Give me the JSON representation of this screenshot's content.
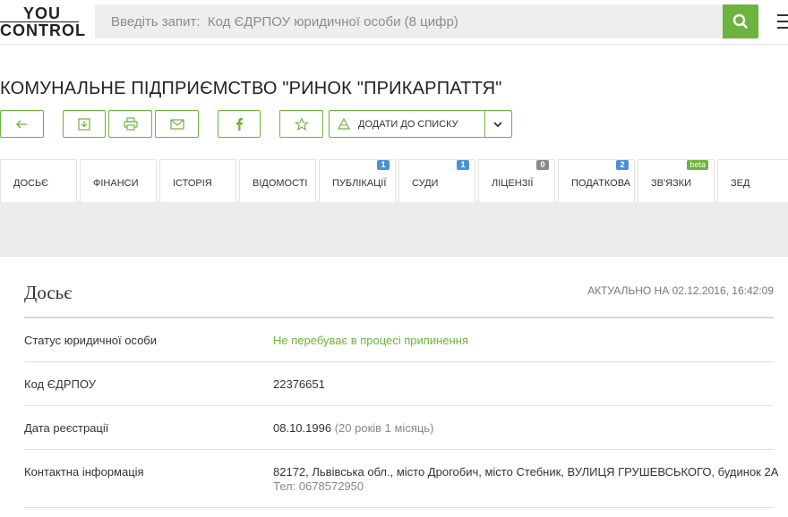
{
  "header": {
    "logo_top": "YOU",
    "logo_bottom": "CONTROL",
    "search_placeholder": "Введіть запит:  Код ЄДРПОУ юридичної особи (8 цифр)"
  },
  "company": {
    "title": "КОМУНАЛЬНЕ ПІДПРИЄМСТВО \"РИНОК \"ПРИКАРПАТТЯ\""
  },
  "actions": {
    "add_to_list_label": "ДОДАТИ ДО СПИСКУ",
    "icons": [
      "back-arrow-icon",
      "download-icon",
      "print-icon",
      "email-icon",
      "facebook-icon",
      "star-icon"
    ]
  },
  "tabs": [
    {
      "label": "Досьє",
      "badge": ""
    },
    {
      "label": "Фінанси",
      "badge": ""
    },
    {
      "label": "Історія",
      "badge": ""
    },
    {
      "label": "Відомості",
      "badge": ""
    },
    {
      "label": "Публікації",
      "badge": "1",
      "badge_color": "#4a90d9"
    },
    {
      "label": "Суди",
      "badge": "1",
      "badge_color": "#4a90d9"
    },
    {
      "label": "Ліцензії",
      "badge": "0",
      "badge_color": "#8a8a8a"
    },
    {
      "label": "Податкова",
      "badge": "2",
      "badge_color": "#4a90d9"
    },
    {
      "label": "Зв'язки",
      "badge": "beta",
      "badge_color": "#6cb33f"
    },
    {
      "label": "ЗЕД",
      "badge": ""
    }
  ],
  "dossier": {
    "title": "Досьє",
    "updated": "АКТУАЛЬНО НА 02.12.2016, 16:42:09",
    "rows": [
      {
        "label": "Статус юридичної особи",
        "value": "Не перебуває в процесі припинення"
      },
      {
        "label": "Код ЄДРПОУ",
        "value": "22376651"
      },
      {
        "label": "Дата реєстрації",
        "value": "08.10.1996",
        "extra": "(20 років 1 місяць)"
      },
      {
        "label": "Контактна інформація",
        "value": "82172, Львівська обл., місто Дрогобич, місто Стебник, ВУЛИЦЯ ГРУШЕВСЬКОГО, будинок 2А",
        "extra": "Тел: 0678572950"
      }
    ]
  },
  "colors": {
    "accent": "#6cb33f",
    "badge_blue": "#4a90d9",
    "badge_grey": "#8a8a8a"
  }
}
